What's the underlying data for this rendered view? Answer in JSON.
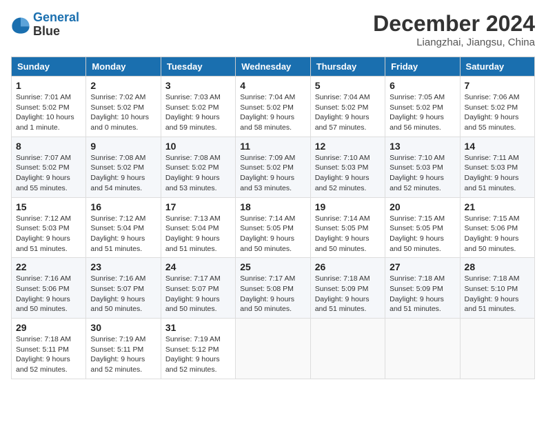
{
  "header": {
    "logo_line1": "General",
    "logo_line2": "Blue",
    "month_title": "December 2024",
    "subtitle": "Liangzhai, Jiangsu, China"
  },
  "weekdays": [
    "Sunday",
    "Monday",
    "Tuesday",
    "Wednesday",
    "Thursday",
    "Friday",
    "Saturday"
  ],
  "weeks": [
    [
      {
        "day": "1",
        "sunrise": "Sunrise: 7:01 AM",
        "sunset": "Sunset: 5:02 PM",
        "daylight": "Daylight: 10 hours and 1 minute."
      },
      {
        "day": "2",
        "sunrise": "Sunrise: 7:02 AM",
        "sunset": "Sunset: 5:02 PM",
        "daylight": "Daylight: 10 hours and 0 minutes."
      },
      {
        "day": "3",
        "sunrise": "Sunrise: 7:03 AM",
        "sunset": "Sunset: 5:02 PM",
        "daylight": "Daylight: 9 hours and 59 minutes."
      },
      {
        "day": "4",
        "sunrise": "Sunrise: 7:04 AM",
        "sunset": "Sunset: 5:02 PM",
        "daylight": "Daylight: 9 hours and 58 minutes."
      },
      {
        "day": "5",
        "sunrise": "Sunrise: 7:04 AM",
        "sunset": "Sunset: 5:02 PM",
        "daylight": "Daylight: 9 hours and 57 minutes."
      },
      {
        "day": "6",
        "sunrise": "Sunrise: 7:05 AM",
        "sunset": "Sunset: 5:02 PM",
        "daylight": "Daylight: 9 hours and 56 minutes."
      },
      {
        "day": "7",
        "sunrise": "Sunrise: 7:06 AM",
        "sunset": "Sunset: 5:02 PM",
        "daylight": "Daylight: 9 hours and 55 minutes."
      }
    ],
    [
      {
        "day": "8",
        "sunrise": "Sunrise: 7:07 AM",
        "sunset": "Sunset: 5:02 PM",
        "daylight": "Daylight: 9 hours and 55 minutes."
      },
      {
        "day": "9",
        "sunrise": "Sunrise: 7:08 AM",
        "sunset": "Sunset: 5:02 PM",
        "daylight": "Daylight: 9 hours and 54 minutes."
      },
      {
        "day": "10",
        "sunrise": "Sunrise: 7:08 AM",
        "sunset": "Sunset: 5:02 PM",
        "daylight": "Daylight: 9 hours and 53 minutes."
      },
      {
        "day": "11",
        "sunrise": "Sunrise: 7:09 AM",
        "sunset": "Sunset: 5:02 PM",
        "daylight": "Daylight: 9 hours and 53 minutes."
      },
      {
        "day": "12",
        "sunrise": "Sunrise: 7:10 AM",
        "sunset": "Sunset: 5:03 PM",
        "daylight": "Daylight: 9 hours and 52 minutes."
      },
      {
        "day": "13",
        "sunrise": "Sunrise: 7:10 AM",
        "sunset": "Sunset: 5:03 PM",
        "daylight": "Daylight: 9 hours and 52 minutes."
      },
      {
        "day": "14",
        "sunrise": "Sunrise: 7:11 AM",
        "sunset": "Sunset: 5:03 PM",
        "daylight": "Daylight: 9 hours and 51 minutes."
      }
    ],
    [
      {
        "day": "15",
        "sunrise": "Sunrise: 7:12 AM",
        "sunset": "Sunset: 5:03 PM",
        "daylight": "Daylight: 9 hours and 51 minutes."
      },
      {
        "day": "16",
        "sunrise": "Sunrise: 7:12 AM",
        "sunset": "Sunset: 5:04 PM",
        "daylight": "Daylight: 9 hours and 51 minutes."
      },
      {
        "day": "17",
        "sunrise": "Sunrise: 7:13 AM",
        "sunset": "Sunset: 5:04 PM",
        "daylight": "Daylight: 9 hours and 51 minutes."
      },
      {
        "day": "18",
        "sunrise": "Sunrise: 7:14 AM",
        "sunset": "Sunset: 5:05 PM",
        "daylight": "Daylight: 9 hours and 50 minutes."
      },
      {
        "day": "19",
        "sunrise": "Sunrise: 7:14 AM",
        "sunset": "Sunset: 5:05 PM",
        "daylight": "Daylight: 9 hours and 50 minutes."
      },
      {
        "day": "20",
        "sunrise": "Sunrise: 7:15 AM",
        "sunset": "Sunset: 5:05 PM",
        "daylight": "Daylight: 9 hours and 50 minutes."
      },
      {
        "day": "21",
        "sunrise": "Sunrise: 7:15 AM",
        "sunset": "Sunset: 5:06 PM",
        "daylight": "Daylight: 9 hours and 50 minutes."
      }
    ],
    [
      {
        "day": "22",
        "sunrise": "Sunrise: 7:16 AM",
        "sunset": "Sunset: 5:06 PM",
        "daylight": "Daylight: 9 hours and 50 minutes."
      },
      {
        "day": "23",
        "sunrise": "Sunrise: 7:16 AM",
        "sunset": "Sunset: 5:07 PM",
        "daylight": "Daylight: 9 hours and 50 minutes."
      },
      {
        "day": "24",
        "sunrise": "Sunrise: 7:17 AM",
        "sunset": "Sunset: 5:07 PM",
        "daylight": "Daylight: 9 hours and 50 minutes."
      },
      {
        "day": "25",
        "sunrise": "Sunrise: 7:17 AM",
        "sunset": "Sunset: 5:08 PM",
        "daylight": "Daylight: 9 hours and 50 minutes."
      },
      {
        "day": "26",
        "sunrise": "Sunrise: 7:18 AM",
        "sunset": "Sunset: 5:09 PM",
        "daylight": "Daylight: 9 hours and 51 minutes."
      },
      {
        "day": "27",
        "sunrise": "Sunrise: 7:18 AM",
        "sunset": "Sunset: 5:09 PM",
        "daylight": "Daylight: 9 hours and 51 minutes."
      },
      {
        "day": "28",
        "sunrise": "Sunrise: 7:18 AM",
        "sunset": "Sunset: 5:10 PM",
        "daylight": "Daylight: 9 hours and 51 minutes."
      }
    ],
    [
      {
        "day": "29",
        "sunrise": "Sunrise: 7:18 AM",
        "sunset": "Sunset: 5:11 PM",
        "daylight": "Daylight: 9 hours and 52 minutes."
      },
      {
        "day": "30",
        "sunrise": "Sunrise: 7:19 AM",
        "sunset": "Sunset: 5:11 PM",
        "daylight": "Daylight: 9 hours and 52 minutes."
      },
      {
        "day": "31",
        "sunrise": "Sunrise: 7:19 AM",
        "sunset": "Sunset: 5:12 PM",
        "daylight": "Daylight: 9 hours and 52 minutes."
      },
      null,
      null,
      null,
      null
    ]
  ]
}
